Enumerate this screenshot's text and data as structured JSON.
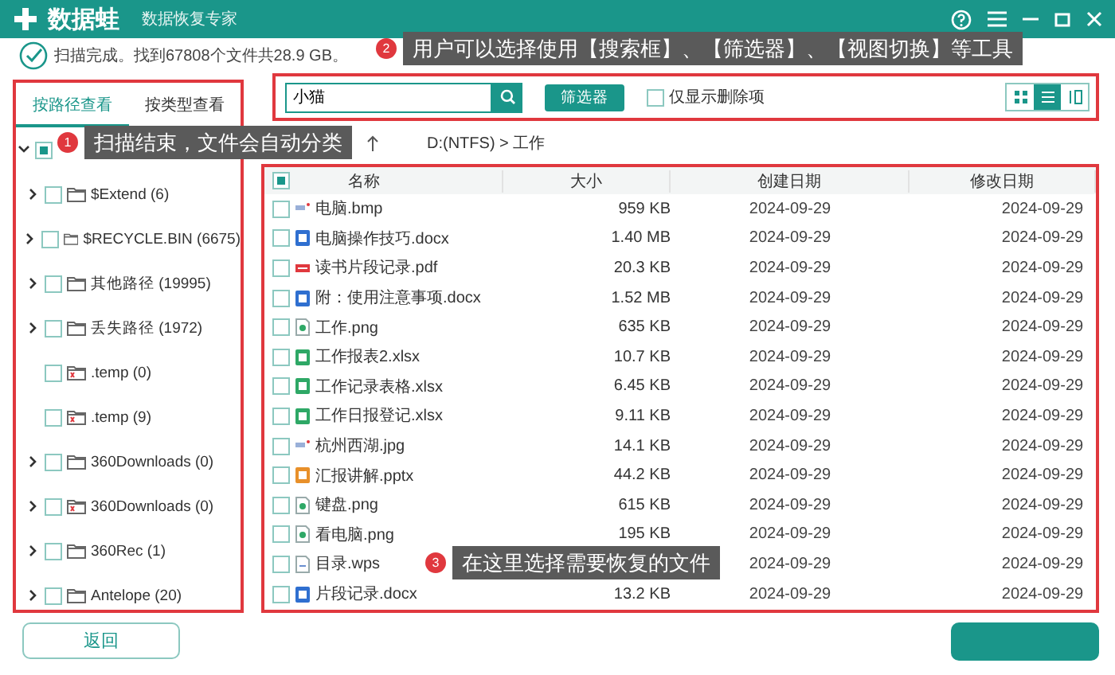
{
  "window": {
    "app_name": "数据蛙",
    "subtitle": "数据恢复专家"
  },
  "status": "扫描完成。找到67808个文件共28.9 GB。",
  "view_tabs": [
    {
      "label": "按路径查看",
      "selected": true
    },
    {
      "label": "按类型查看",
      "selected": false
    }
  ],
  "tree": [
    {
      "expanded": true,
      "partial": true,
      "children": [
        {
          "label": "$Extend (6)",
          "kind": "folder",
          "expandable": true,
          "checked": false
        },
        {
          "label": "$RECYCLE.BIN (6675)",
          "kind": "folder",
          "expandable": true,
          "checked": false
        },
        {
          "label": "其他路径 (19995)",
          "kind": "folder",
          "expandable": true,
          "checked": false
        },
        {
          "label": "丢失路径 (1972)",
          "kind": "folder",
          "expandable": true,
          "checked": false
        },
        {
          "label": ".temp (0)",
          "kind": "deleted",
          "expandable": false,
          "checked": false
        },
        {
          "label": ".temp (9)",
          "kind": "deleted",
          "expandable": false,
          "checked": false
        },
        {
          "label": "360Downloads (0)",
          "kind": "folder",
          "expandable": true,
          "checked": false
        },
        {
          "label": "360Downloads (0)",
          "kind": "deleted",
          "expandable": true,
          "checked": false
        },
        {
          "label": "360Rec (1)",
          "kind": "folder",
          "expandable": true,
          "checked": false
        },
        {
          "label": "Antelope (20)",
          "kind": "folder",
          "expandable": true,
          "checked": false
        }
      ]
    }
  ],
  "search": {
    "value": "小猫"
  },
  "filter_button": "筛选器",
  "deleted_only": {
    "label": "仅显示删除项",
    "checked": false
  },
  "view_modes": [
    {
      "kind": "grid",
      "selected": false
    },
    {
      "kind": "list",
      "selected": true
    },
    {
      "kind": "columns",
      "selected": false
    }
  ],
  "path": "D:(NTFS) > 工作",
  "table": {
    "header_partial": true,
    "columns": [
      "名称",
      "大小",
      "创建日期",
      "修改日期"
    ],
    "rows": [
      {
        "kind": "image",
        "name": "电脑.bmp",
        "size": "959 KB",
        "created": "2024-09-29",
        "modified": "2024-09-29",
        "checked": false
      },
      {
        "kind": "word",
        "name": "电脑操作技巧.docx",
        "size": "1.40 MB",
        "created": "2024-09-29",
        "modified": "2024-09-29",
        "checked": false
      },
      {
        "kind": "pdf",
        "name": "读书片段记录.pdf",
        "size": "20.3 KB",
        "created": "2024-09-29",
        "modified": "2024-09-29",
        "checked": false
      },
      {
        "kind": "word",
        "name": "附：使用注意事项.docx",
        "size": "1.52 MB",
        "created": "2024-09-29",
        "modified": "2024-09-29",
        "checked": false
      },
      {
        "kind": "png",
        "name": "工作.png",
        "size": "635 KB",
        "created": "2024-09-29",
        "modified": "2024-09-29",
        "checked": false
      },
      {
        "kind": "excel",
        "name": "工作报表2.xlsx",
        "size": "10.7 KB",
        "created": "2024-09-29",
        "modified": "2024-09-29",
        "checked": false
      },
      {
        "kind": "excel",
        "name": "工作记录表格.xlsx",
        "size": "6.45 KB",
        "created": "2024-09-29",
        "modified": "2024-09-29",
        "checked": false
      },
      {
        "kind": "excel",
        "name": "工作日报登记.xlsx",
        "size": "9.11 KB",
        "created": "2024-09-29",
        "modified": "2024-09-29",
        "checked": false
      },
      {
        "kind": "image",
        "name": "杭州西湖.jpg",
        "size": "14.1 KB",
        "created": "2024-09-29",
        "modified": "2024-09-29",
        "checked": false
      },
      {
        "kind": "ppt",
        "name": "汇报讲解.pptx",
        "size": "44.2 KB",
        "created": "2024-09-29",
        "modified": "2024-09-29",
        "checked": false
      },
      {
        "kind": "png",
        "name": "键盘.png",
        "size": "615 KB",
        "created": "2024-09-29",
        "modified": "2024-09-29",
        "checked": false
      },
      {
        "kind": "png",
        "name": "看电脑.png",
        "size": "195 KB",
        "created": "2024-09-29",
        "modified": "2024-09-29",
        "checked": false
      },
      {
        "kind": "wps",
        "name": "目录.wps",
        "created": "2024-09-29",
        "modified": "2024-09-29",
        "checked": false
      },
      {
        "kind": "word",
        "name": "片段记录.docx",
        "size": "13.2 KB",
        "created": "2024-09-29",
        "modified": "2024-09-29",
        "checked": false
      }
    ]
  },
  "back_button": "返回",
  "callouts": [
    {
      "number": "1",
      "text": "扫描结束，文件会自动分类"
    },
    {
      "number": "2",
      "text": "用户可以选择使用【搜索框】、【筛选器】、【视图切换】等工具"
    },
    {
      "number": "3",
      "text": "在这里选择需要恢复的文件"
    }
  ]
}
